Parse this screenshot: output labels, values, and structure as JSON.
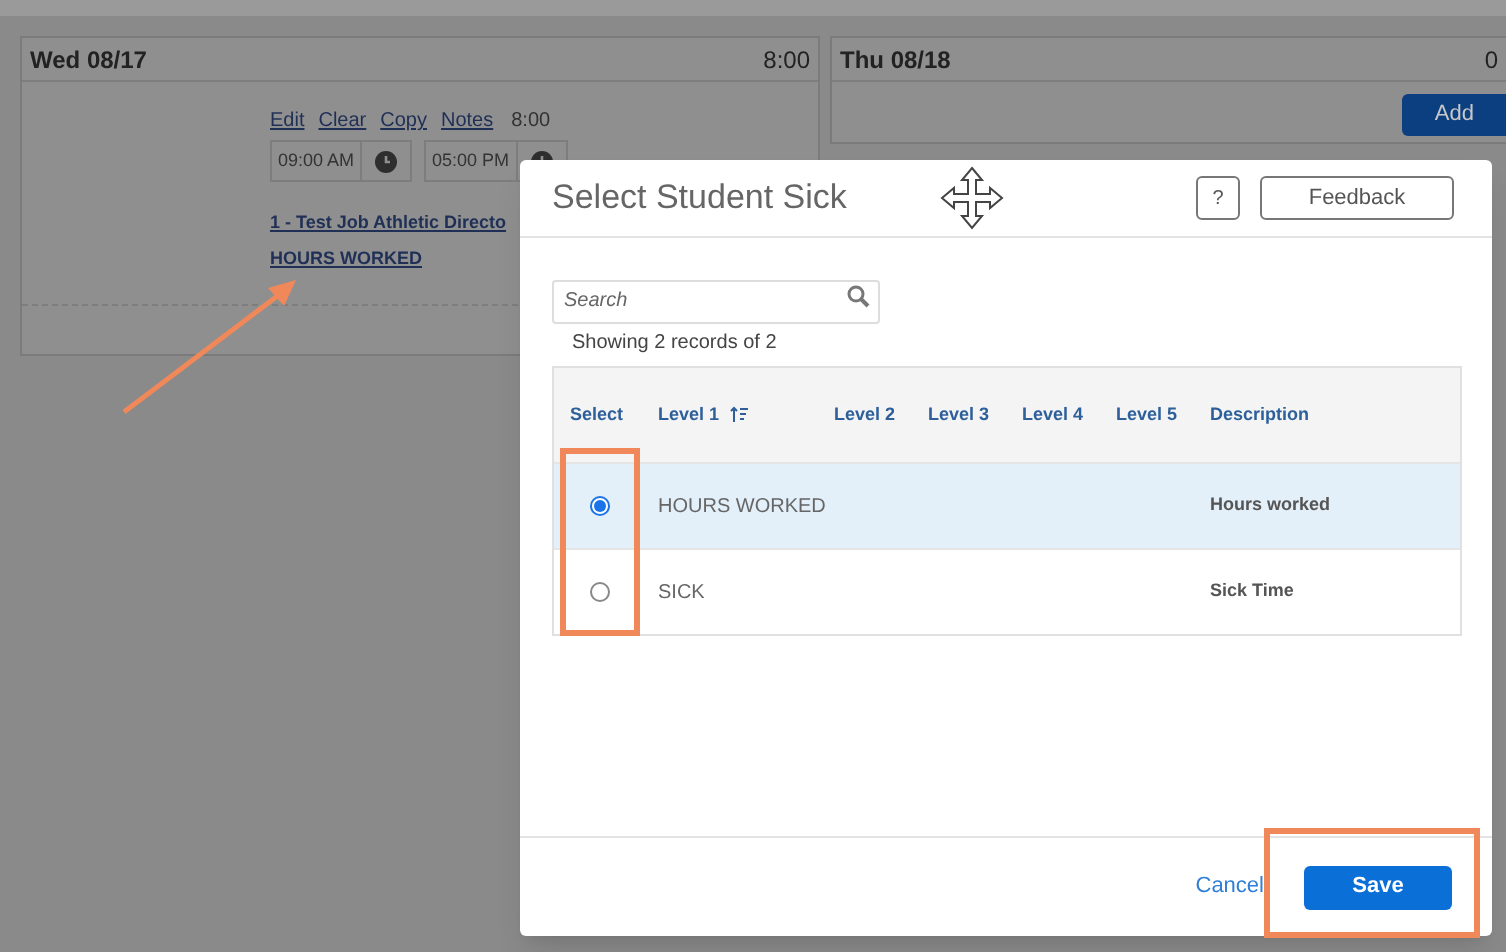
{
  "days": [
    {
      "label": "Wed 08/17",
      "total": "8:00",
      "actions": [
        "Edit",
        "Clear",
        "Copy",
        "Notes"
      ],
      "hours": "8:00",
      "start": "09:00 AM",
      "end": "05:00 PM",
      "entries": [
        "1 - Test Job Athletic Directo",
        "HOURS WORKED"
      ]
    },
    {
      "label": "Thu 08/18",
      "total": "0",
      "add": "Add"
    }
  ],
  "dialog": {
    "title": "Select Student Sick",
    "help": "?",
    "feedback": "Feedback",
    "search": {
      "placeholder": "Search"
    },
    "records": "Showing 2 records of 2",
    "columns": [
      "Select",
      "Level 1",
      "Level 2",
      "Level 3",
      "Level 4",
      "Level 5",
      "Description"
    ],
    "rows": [
      {
        "level_1": "HOURS WORKED",
        "description": "Hours worked",
        "selected": true
      },
      {
        "level_1": "SICK",
        "description": "Sick Time",
        "selected": false
      }
    ],
    "cancel": "Cancel",
    "save": "Save"
  }
}
